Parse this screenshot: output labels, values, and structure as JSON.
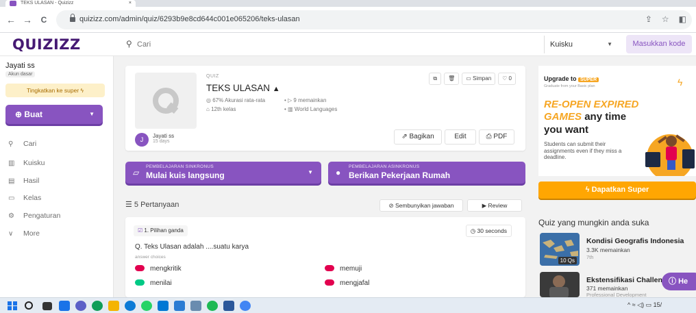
{
  "browser": {
    "tab_title": "TEKS ULASAN - Quizizz",
    "tab_close": "×",
    "back": "←",
    "forward": "→",
    "reload": "C",
    "url": "quizizz.com/admin/quiz/6293b9e8cd644c001e065206/teks-ulasan"
  },
  "header": {
    "logo": "QUIZIZZ",
    "search_placeholder": "Cari",
    "library_select": "Kuisku",
    "join_button": "Masukkan kode"
  },
  "sidebar": {
    "user_name": "Jayati ss",
    "account_type": "Akun dasar",
    "upgrade_label": "Tingkatkan ke super",
    "create_label": "Buat",
    "items": [
      {
        "label": "Cari",
        "icon": "search-icon"
      },
      {
        "label": "Kuisku",
        "icon": "library-icon"
      },
      {
        "label": "Hasil",
        "icon": "reports-icon"
      },
      {
        "label": "Kelas",
        "icon": "classes-icon"
      },
      {
        "label": "Pengaturan",
        "icon": "settings-icon"
      },
      {
        "label": "More",
        "icon": "chevron-down-icon"
      }
    ]
  },
  "quiz": {
    "type_label": "QUIZ",
    "title": "TEKS ULASAN",
    "accuracy": "67% Akurasi rata-rata",
    "plays": "9 memainkan",
    "grade": "12th kelas",
    "subject": "World Languages",
    "save_label": "Simpan",
    "likes": "0",
    "owner_initial": "J",
    "owner_name": "Jayati ss",
    "owner_time": "15 days",
    "share_label": "Bagikan",
    "edit_label": "Edit",
    "pdf_label": "PDF"
  },
  "start": {
    "sync_sub": "PEMBELAJARAN SINKRONUS",
    "sync_main": "Mulai kuis langsung",
    "async_sub": "PEMBELAJARAN ASINKRONUS",
    "async_main": "Berikan Pekerjaan Rumah"
  },
  "questions": {
    "count_label": "5 Pertanyaan",
    "hide_answers": "Sembunyikan jawaban",
    "review": "Review",
    "items": [
      {
        "kind": "1. Pilihan ganda",
        "time": "30 seconds",
        "text": "Q. Teks Ulasan adalah ....suatu karya",
        "choices_label": "answer choices",
        "choices": [
          {
            "text": "mengkritik",
            "color": "#e2004f"
          },
          {
            "text": "memuji",
            "color": "#e2004f"
          },
          {
            "text": "menilai",
            "color": "#00c985"
          },
          {
            "text": "mengjafal",
            "color": "#e2004f"
          }
        ]
      }
    ]
  },
  "promo": {
    "upgrade_to": "Upgrade to",
    "super_badge": "SUPER",
    "graduate": "Graduate from your Basic plan",
    "line1": "RE-OPEN EXPIRED",
    "line2_a": "GAMES",
    "line2_b": "any time",
    "line3": "you want",
    "body": "Students can submit their assignments even if they miss a deadline.",
    "cta": "Dapatkan Super"
  },
  "suggestions": {
    "title": "Quiz yang mungkin anda suka",
    "items": [
      {
        "title": "Kondisi Geografis Indonesia",
        "plays": "3.3K memainkan",
        "grade": "7th",
        "count": "10 Qs"
      },
      {
        "title": "Ekstensifikasi Challen",
        "plays": "371 memainkan",
        "grade": "Professional Development"
      }
    ]
  },
  "help": {
    "label": "He"
  },
  "taskbar": {
    "tray_time": "15/"
  },
  "colors": {
    "brand": "#8854c0",
    "brand_dark": "#461a73",
    "super_orange": "#ffa602",
    "correct": "#00c985",
    "incorrect": "#e2004f"
  }
}
